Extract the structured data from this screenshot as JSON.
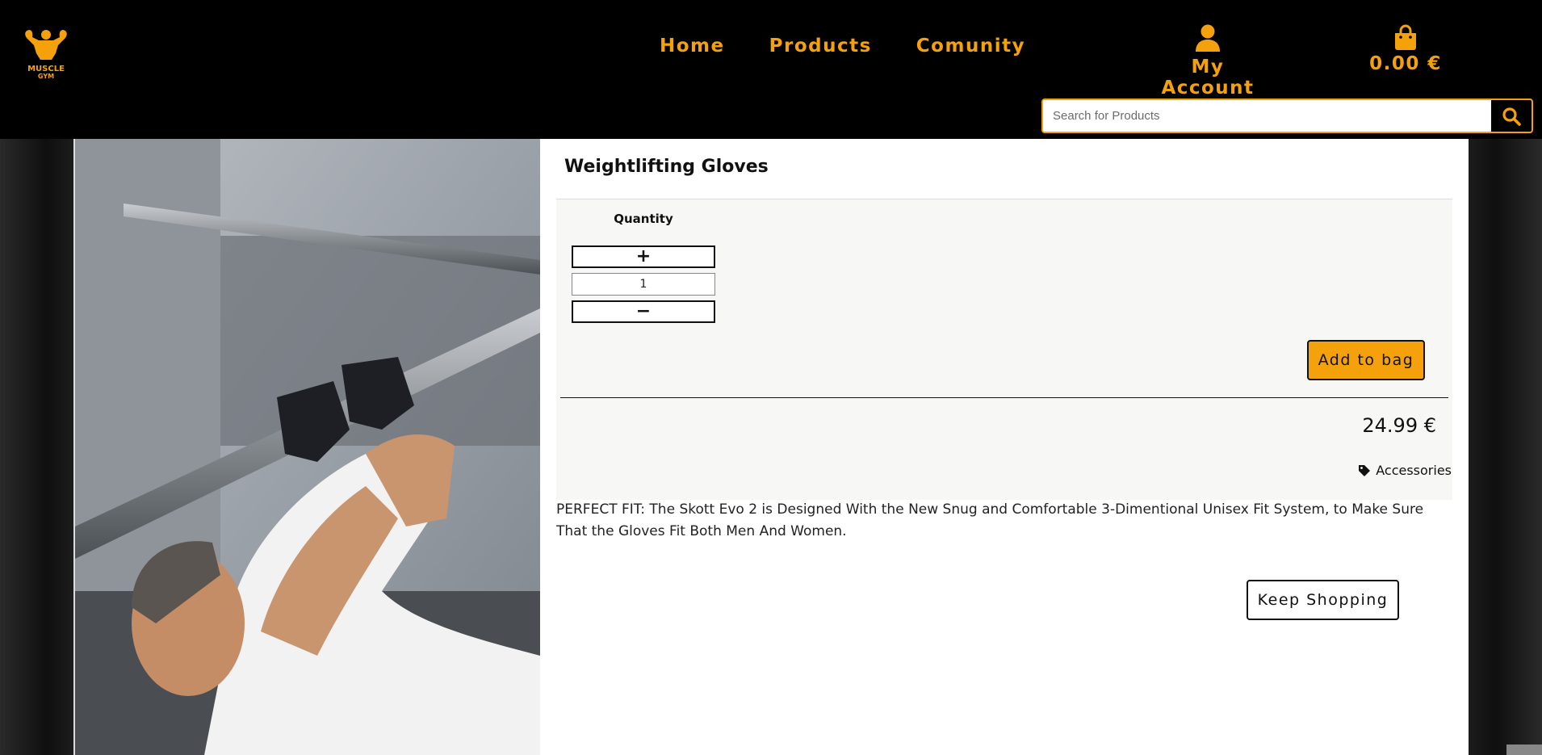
{
  "header": {
    "logo_text": "MUSCLE GYM",
    "nav": [
      {
        "label": "Home"
      },
      {
        "label": "Products"
      },
      {
        "label": "Comunity"
      }
    ],
    "account_label": "My Account",
    "bag_total": "0.00 €",
    "search": {
      "placeholder": "Search for Products"
    }
  },
  "product": {
    "title": "Weightlifting Gloves",
    "quantity_label": "Quantity",
    "quantity_value": "1",
    "plus_label": "+",
    "minus_label": "−",
    "add_to_bag_label": "Add to bag",
    "price": "24.99 €",
    "category": "Accessories",
    "description": "PERFECT FIT: The Skott Evo 2 is Designed With the New Snug and Comfortable 3-Dimentional Unisex Fit System, to Make Sure That the Gloves Fit Both Men And Women.",
    "keep_shopping_label": "Keep Shopping"
  },
  "colors": {
    "accent": "#f5a10b",
    "header_bg": "#000000",
    "panel_bg": "#f7f7f5"
  },
  "icons": {
    "logo": "bodybuilder-logo-icon",
    "account": "user-icon",
    "bag": "shopping-bag-icon",
    "search": "search-icon",
    "category": "tag-icon"
  }
}
